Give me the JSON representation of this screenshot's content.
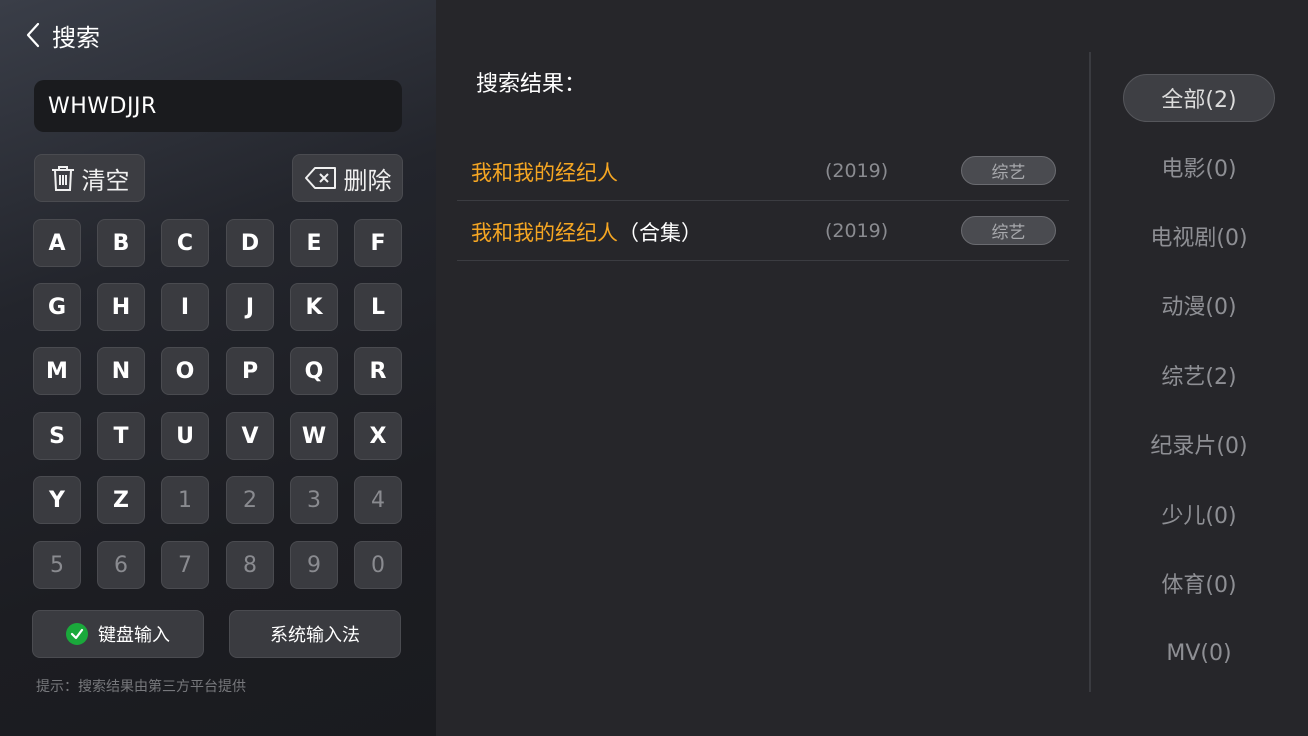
{
  "header": {
    "title": "搜索"
  },
  "search": {
    "value": "WHWDJJR"
  },
  "actions": {
    "clear_label": "清空",
    "delete_label": "删除"
  },
  "keyboard": {
    "rows": [
      [
        "A",
        "B",
        "C",
        "D",
        "E",
        "F"
      ],
      [
        "G",
        "H",
        "I",
        "J",
        "K",
        "L"
      ],
      [
        "M",
        "N",
        "O",
        "P",
        "Q",
        "R"
      ],
      [
        "S",
        "T",
        "U",
        "V",
        "W",
        "X"
      ],
      [
        "Y",
        "Z",
        "1",
        "2",
        "3",
        "4"
      ],
      [
        "5",
        "6",
        "7",
        "8",
        "9",
        "0"
      ]
    ]
  },
  "input_modes": {
    "keyboard_label": "键盘输入",
    "system_label": "系统输入法"
  },
  "hint": "提示：搜索结果由第三方平台提供",
  "results": {
    "title": "搜索结果：",
    "items": [
      {
        "title": "我和我的经纪人",
        "suffix": "",
        "year": "(2019)",
        "tag": "综艺"
      },
      {
        "title": "我和我的经纪人",
        "suffix": "（合集）",
        "year": "(2019)",
        "tag": "综艺"
      }
    ]
  },
  "categories": [
    {
      "label": "全部(2)",
      "active": true
    },
    {
      "label": "电影(0)"
    },
    {
      "label": "电视剧(0)"
    },
    {
      "label": "动漫(0)"
    },
    {
      "label": "综艺(2)"
    },
    {
      "label": "纪录片(0)"
    },
    {
      "label": "少儿(0)"
    },
    {
      "label": "体育(0)"
    },
    {
      "label": "MV(0)"
    }
  ],
  "colors": {
    "accent": "#f5a623",
    "check": "#1aa93b",
    "background": "#26262a"
  }
}
